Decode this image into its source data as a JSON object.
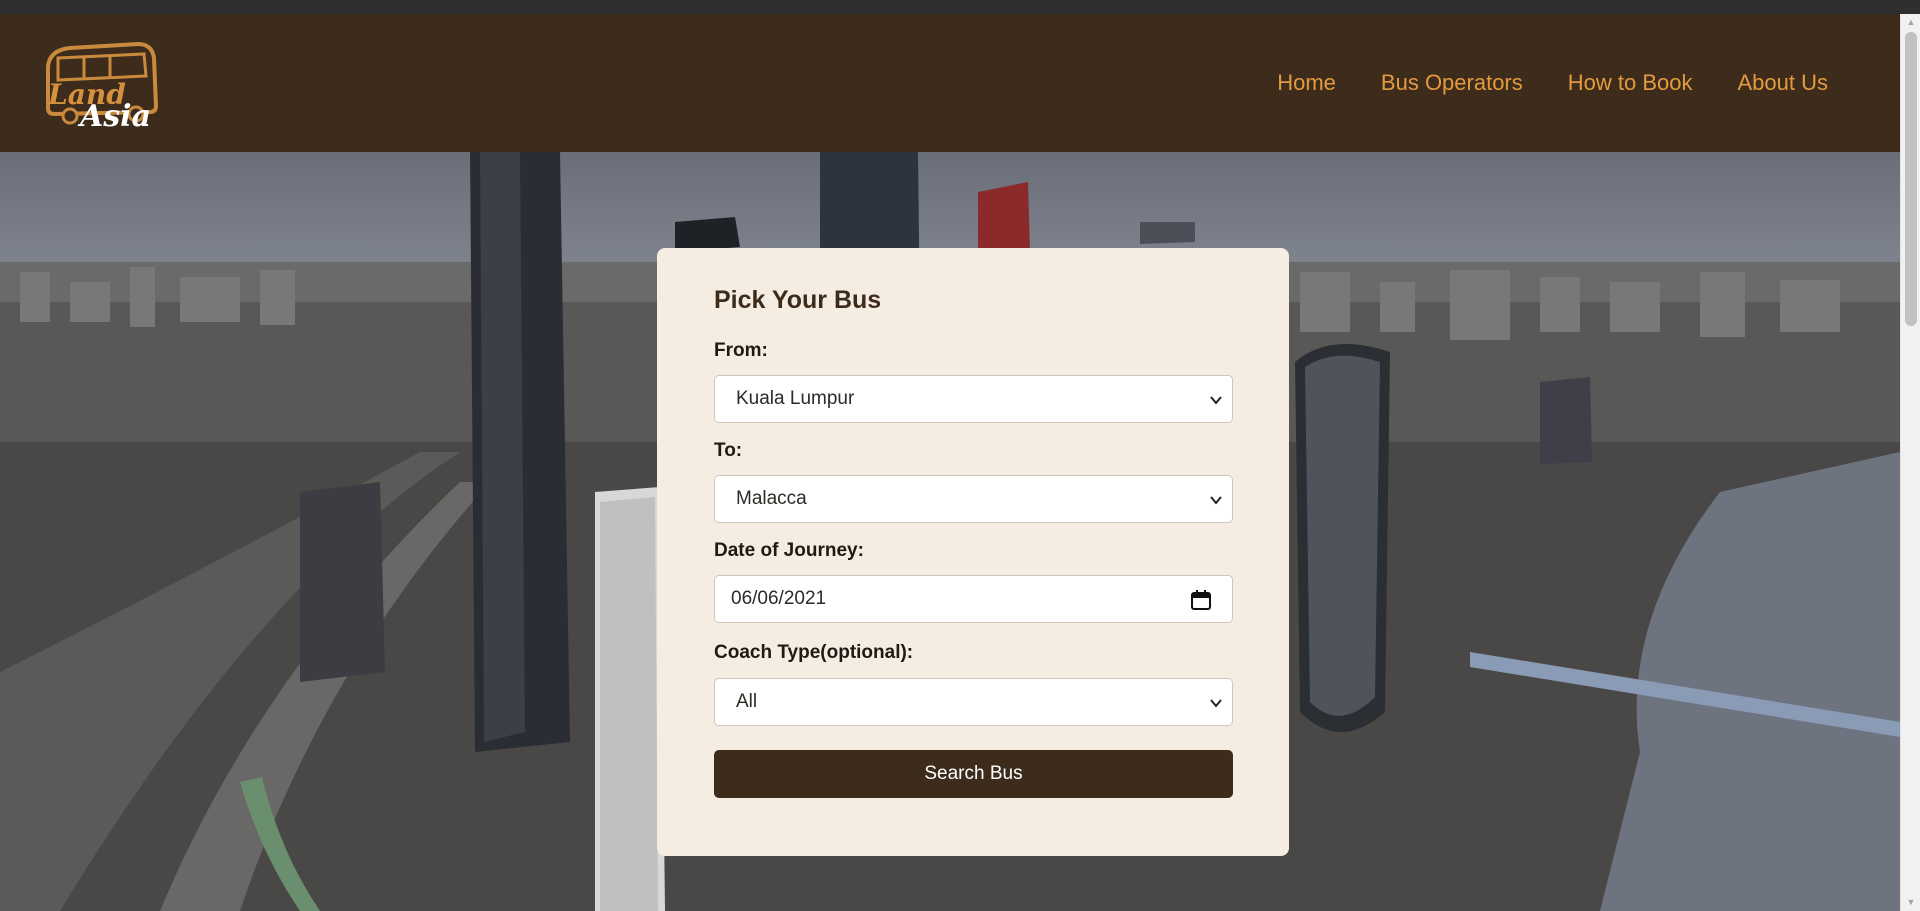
{
  "brand": {
    "logo_line1": "Land",
    "logo_line2": "Asia",
    "color_primary": "#3d2c1b",
    "color_accent": "#e49a3e",
    "color_card": "#f6ede2"
  },
  "nav": {
    "items": [
      {
        "label": "Home"
      },
      {
        "label": "Bus Operators"
      },
      {
        "label": "How to Book"
      },
      {
        "label": "About Us"
      }
    ]
  },
  "form": {
    "title": "Pick Your Bus",
    "from": {
      "label": "From:",
      "value": "Kuala Lumpur",
      "icon": "chevron-down-icon"
    },
    "to": {
      "label": "To:",
      "value": "Malacca",
      "icon": "chevron-down-icon"
    },
    "date": {
      "label": "Date of Journey:",
      "value": "06/06/2021",
      "icon": "calendar-icon"
    },
    "coach": {
      "label": "Coach Type(optional):",
      "value": "All",
      "icon": "chevron-down-icon"
    },
    "submit_label": "Search Bus"
  }
}
